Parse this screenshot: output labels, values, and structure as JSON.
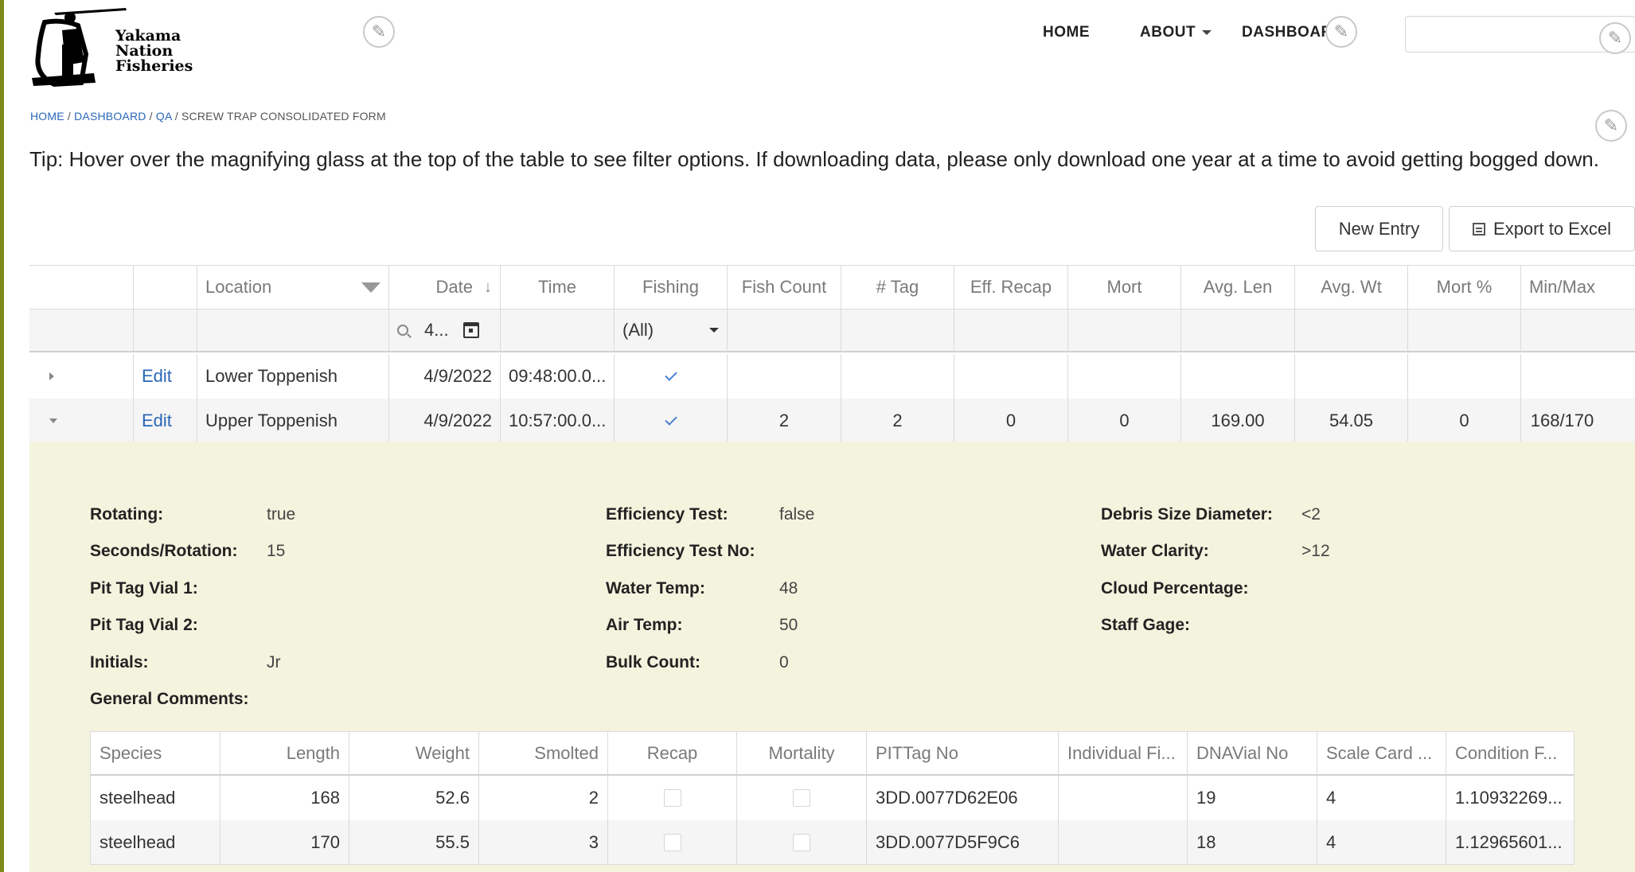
{
  "header": {
    "logo_lines": [
      "Yakama",
      "Nation",
      "Fisheries"
    ],
    "nav": {
      "home": "HOME",
      "about": "ABOUT",
      "dashboard": "DASHBOARD"
    }
  },
  "breadcrumb": {
    "home": "HOME",
    "dashboard": "DASHBOARD",
    "qa": "QA",
    "current": "SCREW TRAP CONSOLIDATED FORM",
    "sep": " / "
  },
  "tip": "Tip: Hover over the magnifying glass at the top of the table to see filter options. If downloading data, please only download one year at a time to avoid getting bogged down.",
  "buttons": {
    "new_entry": "New Entry",
    "export": "Export to Excel"
  },
  "grid": {
    "columns": [
      "",
      "",
      "Location",
      "Date",
      "Time",
      "Fishing",
      "Fish Count",
      "# Tag",
      "Eff. Recap",
      "Mort",
      "Avg. Len",
      "Avg. Wt",
      "Mort %",
      "Min/Max"
    ],
    "filters": {
      "date": "4...",
      "fishing": "(All)"
    },
    "rows": [
      {
        "edit": "Edit",
        "location": "Lower Toppenish",
        "date": "4/9/2022",
        "time": "09:48:00.0...",
        "fish_count": "",
        "tag": "",
        "eff_recap": "",
        "mort": "",
        "avg_len": "",
        "avg_wt": "",
        "mort_pct": "",
        "min_max": ""
      },
      {
        "edit": "Edit",
        "location": "Upper Toppenish",
        "date": "4/9/2022",
        "time": "10:57:00.0...",
        "fish_count": "2",
        "tag": "2",
        "eff_recap": "0",
        "mort": "0",
        "avg_len": "169.00",
        "avg_wt": "54.05",
        "mort_pct": "0",
        "min_max": "168/170"
      }
    ]
  },
  "detail": {
    "col1": [
      {
        "label": "Rotating:",
        "value": "true"
      },
      {
        "label": "Seconds/Rotation:",
        "value": "15"
      },
      {
        "label": "Pit Tag Vial 1:",
        "value": ""
      },
      {
        "label": "Pit Tag Vial 2:",
        "value": ""
      },
      {
        "label": "Initials:",
        "value": "Jr"
      },
      {
        "label": "General Comments:",
        "value": ""
      }
    ],
    "col2": [
      {
        "label": "Efficiency Test:",
        "value": "false"
      },
      {
        "label": "Efficiency Test No:",
        "value": ""
      },
      {
        "label": "Water Temp:",
        "value": "48"
      },
      {
        "label": "Air Temp:",
        "value": "50"
      },
      {
        "label": "Bulk Count:",
        "value": "0"
      }
    ],
    "col3": [
      {
        "label": "Debris Size Diameter:",
        "value": "<2"
      },
      {
        "label": "Water Clarity:",
        "value": ">12"
      },
      {
        "label": "Cloud Percentage:",
        "value": ""
      },
      {
        "label": "Staff Gage:",
        "value": ""
      }
    ]
  },
  "subgrid": {
    "columns": [
      "Species",
      "Length",
      "Weight",
      "Smolted",
      "Recap",
      "Mortality",
      "PITTag No",
      "Individual Fi...",
      "DNAVial No",
      "Scale Card ...",
      "Condition F..."
    ],
    "rows": [
      {
        "species": "steelhead",
        "length": "168",
        "weight": "52.6",
        "smolted": "2",
        "pittag": "3DD.0077D62E06",
        "individual": "",
        "dnavial": "19",
        "scale_card": "4",
        "condition": "1.10932269..."
      },
      {
        "species": "steelhead",
        "length": "170",
        "weight": "55.5",
        "smolted": "3",
        "pittag": "3DD.0077D5F9C6",
        "individual": "",
        "dnavial": "18",
        "scale_card": "4",
        "condition": "1.12965601..."
      }
    ]
  }
}
